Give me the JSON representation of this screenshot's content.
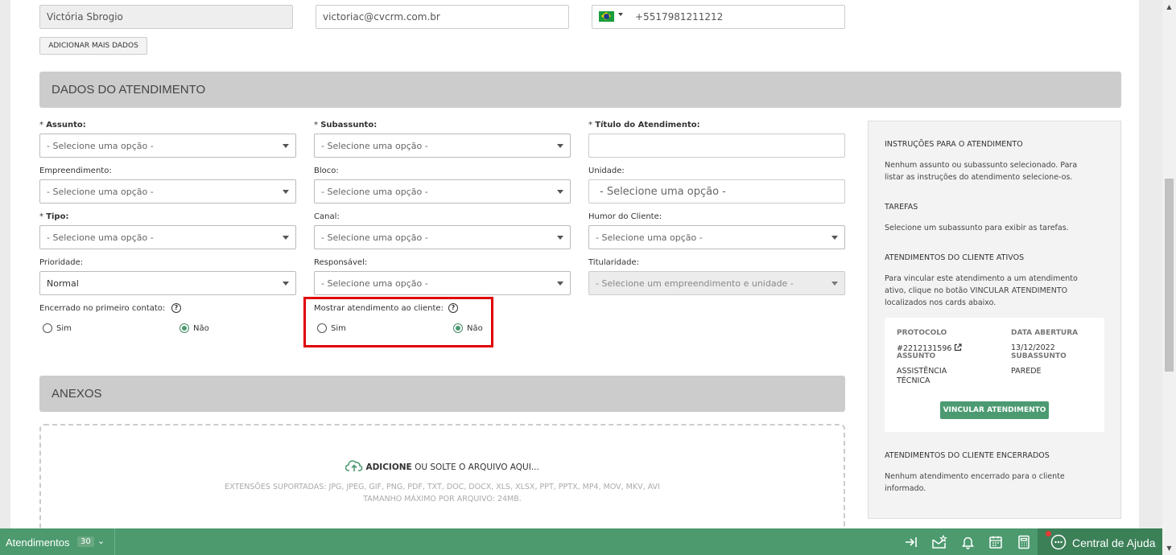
{
  "contact": {
    "name": "Victória Sbrogio",
    "email": "victoriac@cvcrm.com.br",
    "phone": "+5517981211212",
    "add_more_label": "ADICIONAR MAIS DADOS"
  },
  "section_attendance": {
    "title": "DADOS DO ATENDIMENTO",
    "fields": {
      "assunto": {
        "label": "Assunto:",
        "value": "- Selecione uma opção -"
      },
      "subassunto": {
        "label": "Subassunto:",
        "value": "- Selecione uma opção -"
      },
      "titulo": {
        "label": "Título do Atendimento:",
        "value": ""
      },
      "empreendimento": {
        "label": "Empreendimento:",
        "value": "- Selecione uma opção -"
      },
      "bloco": {
        "label": "Bloco:",
        "value": "- Selecione uma opção -"
      },
      "unidade": {
        "label": "Unidade:",
        "value": "- Selecione uma opção -"
      },
      "tipo": {
        "label": "Tipo:",
        "value": "- Selecione uma opção -"
      },
      "canal": {
        "label": "Canal:",
        "value": "- Selecione uma opção -"
      },
      "humor": {
        "label": "Humor do Cliente:",
        "value": "- Selecione uma opção -"
      },
      "prioridade": {
        "label": "Prioridade:",
        "value": "Normal"
      },
      "responsavel": {
        "label": "Responsável:",
        "value": "- Selecione uma opção -"
      },
      "titularidade": {
        "label": "Titularidade:",
        "value": "- Selecione um empreendimento e unidade -"
      }
    },
    "required_mark": "*",
    "encerrado": {
      "label": "Encerrado no primeiro contato:",
      "yes": "Sim",
      "no": "Não",
      "selected": "Não"
    },
    "mostrar": {
      "label": "Mostrar atendimento ao cliente:",
      "yes": "Sim",
      "no": "Não",
      "selected": "Não"
    },
    "help_glyph": "?"
  },
  "section_attachments": {
    "title": "ANEXOS",
    "drop_action": "ADICIONE",
    "drop_rest": "OU SOLTE O ARQUIVO AQUI...",
    "extensions": "EXTENSÕES SUPORTADAS: JPG, JPEG, GIF, PNG, PDF, TXT, DOC, DOCX, XLS, XLSX, PPT, PPTX, MP4, MOV, MKV, AVI",
    "max_size": "TAMANHO MÁXIMO POR ARQUIVO: 24MB."
  },
  "side_panel": {
    "instructions_title": "INSTRUÇÕES PARA O ATENDIMENTO",
    "instructions_text_1": "Nenhum assunto ou subassunto selecionado. Para",
    "instructions_text_2": "listar as instruções do atendimento selecione-os.",
    "tasks_title": "TAREFAS",
    "tasks_text": "Selecione um subassunto para exibir as tarefas.",
    "active_title": "ATENDIMENTOS DO CLIENTE ATIVOS",
    "active_text_1": "Para vincular este atendimento a um atendimento",
    "active_text_2": "ativo, clique no botão VINCULAR ATENDIMENTO",
    "active_text_3": "localizados nos cards abaixo.",
    "card": {
      "protocol_label": "PROTOCOLO",
      "protocol_value": "#2212131596",
      "date_label": "DATA ABERTURA",
      "date_value": "13/12/2022",
      "subject_label": "ASSUNTO",
      "subject_value_1": "ASSISTÊNCIA",
      "subject_value_2": "TÉCNICA",
      "subsubject_label": "SUBASSUNTO",
      "subsubject_value": "PAREDE",
      "link_button": "VINCULAR ATENDIMENTO"
    },
    "closed_title": "ATENDIMENTOS DO CLIENTE ENCERRADOS",
    "closed_text_1": "Nenhum atendimento encerrado para o cliente",
    "closed_text_2": "informado."
  },
  "footer": {
    "attendances_label": "Atendimentos",
    "attendances_count": "30",
    "help_center": "Central de Ajuda"
  },
  "colors": {
    "accent": "#4c9a6e",
    "highlight": "#e00000",
    "band": "#cccccc"
  }
}
